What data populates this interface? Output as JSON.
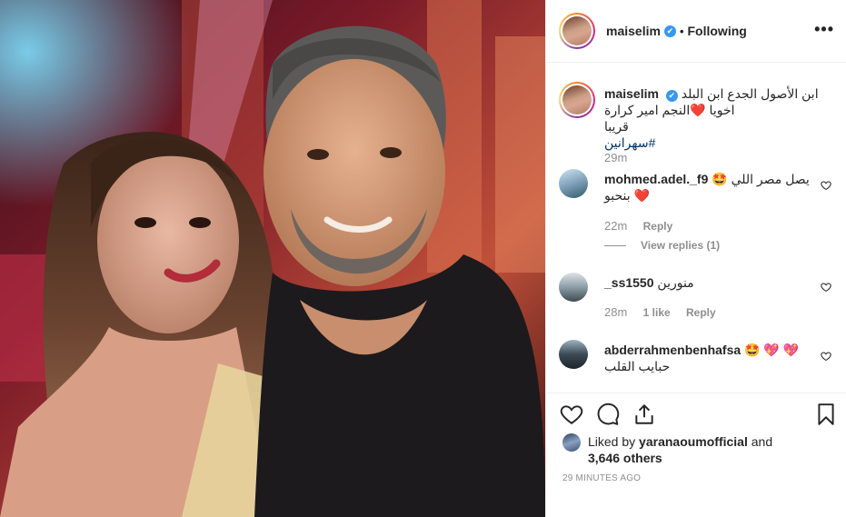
{
  "post": {
    "username": "maiselim",
    "verified_mark": "✔",
    "separator": "•",
    "follow_status": "Following",
    "more_label": "•••"
  },
  "caption": {
    "username": "maiselim",
    "lines": [
      "ابن الأصول الجدع ابن البلد",
      "اخويا ❤️النجم امير كرارة",
      "قريبا"
    ],
    "hashtag": "#سهرانين",
    "time": "29m"
  },
  "comments": [
    {
      "username": "mohmed.adel._f9",
      "text": "يصل مصر اللي 🤩 ❤️ بنحبو",
      "time": "22m",
      "reply_label": "Reply",
      "view_replies": "View replies (1)"
    },
    {
      "username": "_ss1550",
      "text": "منورين",
      "time": "28m",
      "likes": "1 like",
      "reply_label": "Reply"
    },
    {
      "username": "abderrahmenbenhafsa",
      "text": "🤩 💖 💖",
      "text2": "حبايب القلب"
    }
  ],
  "actions": {
    "liked_by_prefix": "Liked by",
    "liked_by_user": "yaranaoumofficial",
    "liked_by_and": "and",
    "others": "3,646 others",
    "posted_ago": "29 MINUTES AGO"
  },
  "icons": {
    "like": "heart-icon",
    "comment": "comment-icon",
    "share": "share-icon",
    "save": "bookmark-icon",
    "comment_like": "small-heart-icon",
    "more": "more-icon"
  },
  "colors": {
    "verified": "#3897f0",
    "text": "#262626",
    "muted": "#8e8e8e",
    "hashtag": "#003569"
  }
}
